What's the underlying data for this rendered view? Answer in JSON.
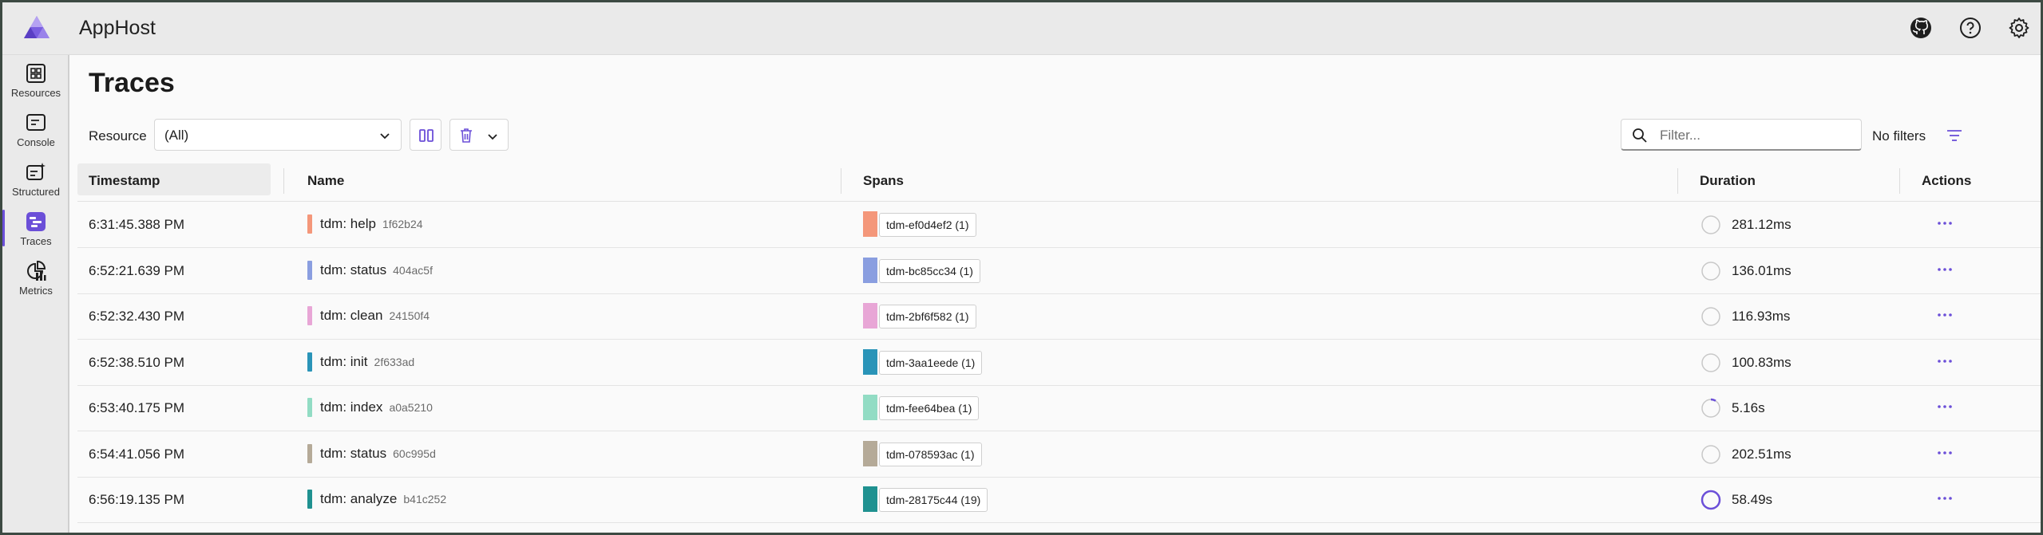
{
  "app": {
    "title": "AppHost"
  },
  "header": {
    "icons": [
      "github-icon",
      "help-icon",
      "settings-icon"
    ]
  },
  "nav": {
    "items": [
      {
        "label": "Resources",
        "icon": "resources-icon",
        "active": false
      },
      {
        "label": "Console",
        "icon": "console-icon",
        "active": false
      },
      {
        "label": "Structured",
        "icon": "structured-icon",
        "active": false
      },
      {
        "label": "Traces",
        "icon": "traces-icon",
        "active": true
      },
      {
        "label": "Metrics",
        "icon": "metrics-icon",
        "active": false
      }
    ]
  },
  "page": {
    "title": "Traces"
  },
  "toolbar": {
    "resource_label": "Resource",
    "resource_value": "(All)",
    "filter_placeholder": "Filter...",
    "no_filters": "No filters"
  },
  "table": {
    "columns": {
      "timestamp": "Timestamp",
      "name": "Name",
      "spans": "Spans",
      "duration": "Duration",
      "actions": "Actions"
    },
    "rows": [
      {
        "timestamp": "6:31:45.388 PM",
        "name": "tdm: help",
        "trace_id": "1f62b24",
        "color": "#f4977a",
        "span": "tdm-ef0d4ef2 (1)",
        "duration": "281.12ms",
        "progress": 0
      },
      {
        "timestamp": "6:52:21.639 PM",
        "name": "tdm: status",
        "trace_id": "404ac5f",
        "color": "#8a9ee0",
        "span": "tdm-bc85cc34 (1)",
        "duration": "136.01ms",
        "progress": 0
      },
      {
        "timestamp": "6:52:32.430 PM",
        "name": "tdm: clean",
        "trace_id": "24150f4",
        "color": "#e8a6d6",
        "span": "tdm-2bf6f582 (1)",
        "duration": "116.93ms",
        "progress": 0
      },
      {
        "timestamp": "6:52:38.510 PM",
        "name": "tdm: init",
        "trace_id": "2f633ad",
        "color": "#2a94b8",
        "span": "tdm-3aa1eede (1)",
        "duration": "100.83ms",
        "progress": 0
      },
      {
        "timestamp": "6:53:40.175 PM",
        "name": "tdm: index",
        "trace_id": "a0a5210",
        "color": "#92dcc4",
        "span": "tdm-fee64bea (1)",
        "duration": "5.16s",
        "progress": 0.09
      },
      {
        "timestamp": "6:54:41.056 PM",
        "name": "tdm: status",
        "trace_id": "60c995d",
        "color": "#b5aa98",
        "span": "tdm-078593ac (1)",
        "duration": "202.51ms",
        "progress": 0
      },
      {
        "timestamp": "6:56:19.135 PM",
        "name": "tdm: analyze",
        "trace_id": "b41c252",
        "color": "#1f9190",
        "span": "tdm-28175c44 (19)",
        "duration": "58.49s",
        "progress": 1
      }
    ]
  },
  "colors": {
    "accent": "#6b4fd8"
  }
}
